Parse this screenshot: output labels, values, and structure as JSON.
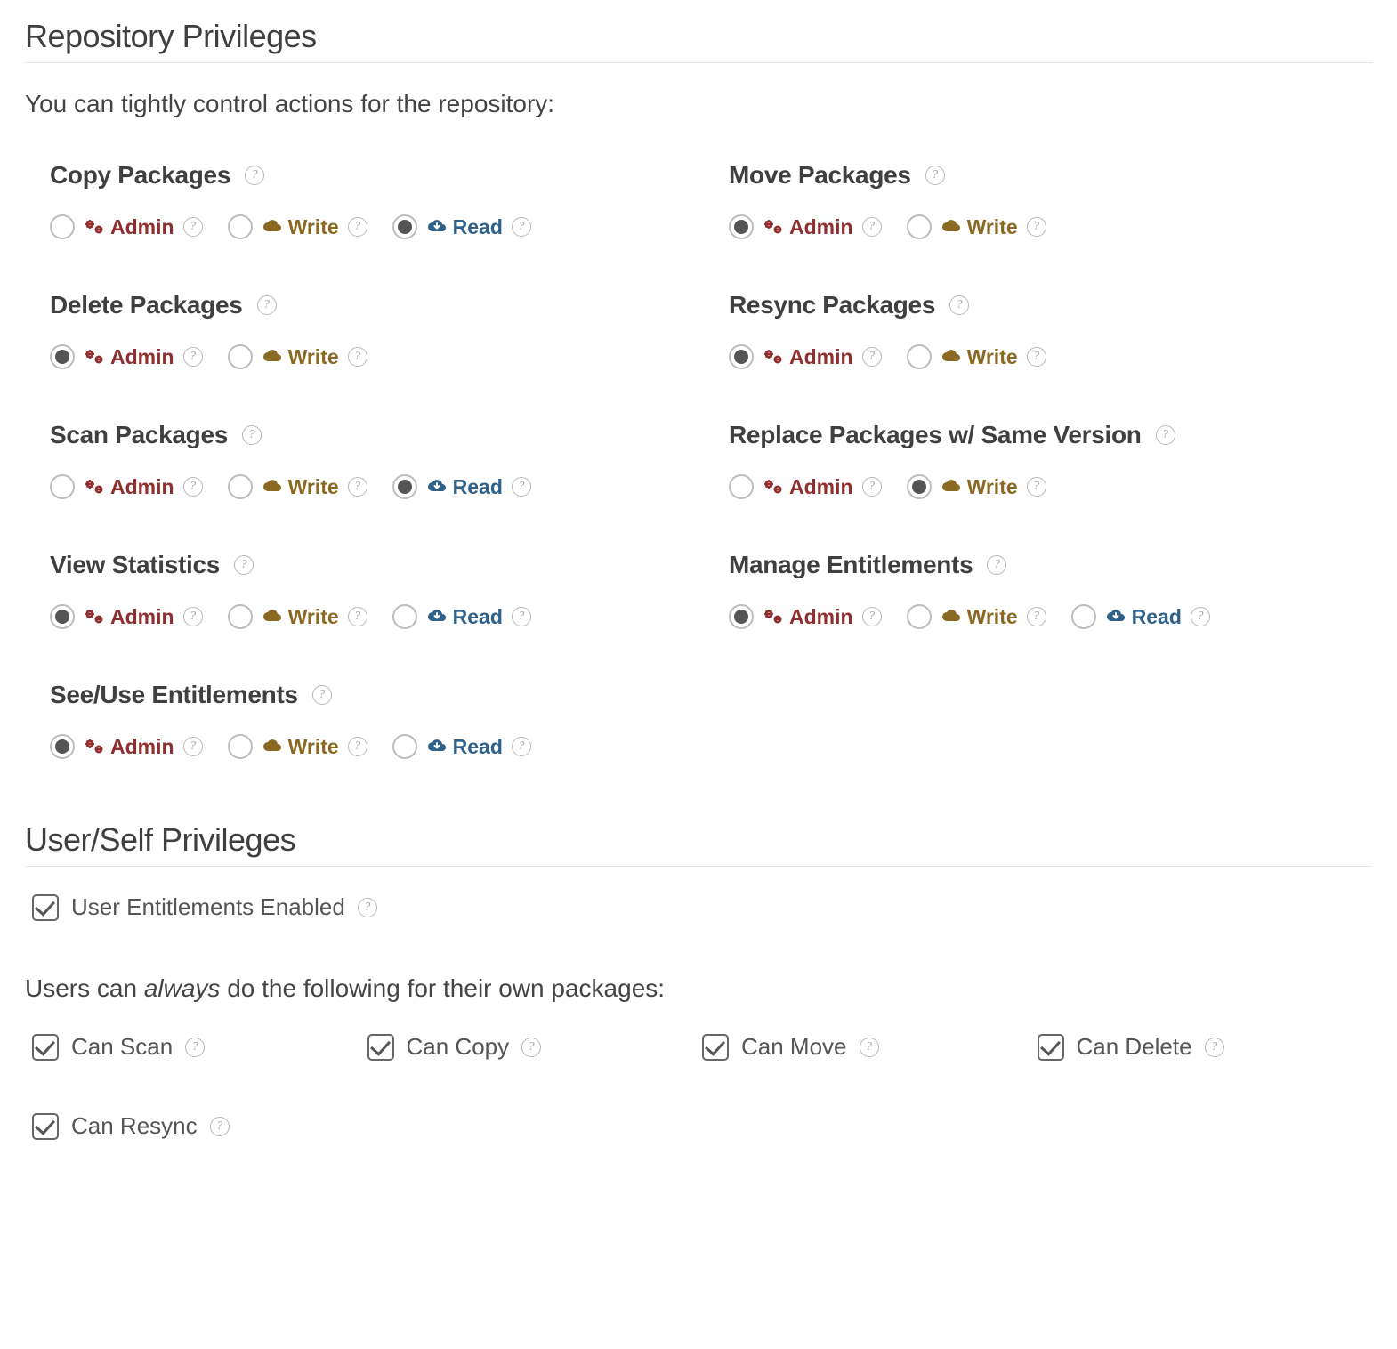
{
  "repo": {
    "title": "Repository Privileges",
    "desc": "You can tightly control actions for the repository:",
    "labels": {
      "admin": "Admin",
      "write": "Write",
      "read": "Read"
    },
    "blocks": [
      {
        "key": "copy",
        "title": "Copy Packages",
        "opts": [
          "admin",
          "write",
          "read"
        ],
        "selected": "read"
      },
      {
        "key": "move",
        "title": "Move Packages",
        "opts": [
          "admin",
          "write"
        ],
        "selected": "admin"
      },
      {
        "key": "delete",
        "title": "Delete Packages",
        "opts": [
          "admin",
          "write"
        ],
        "selected": "admin"
      },
      {
        "key": "resync",
        "title": "Resync Packages",
        "opts": [
          "admin",
          "write"
        ],
        "selected": "admin"
      },
      {
        "key": "scan",
        "title": "Scan Packages",
        "opts": [
          "admin",
          "write",
          "read"
        ],
        "selected": "read"
      },
      {
        "key": "replace",
        "title": "Replace Packages w/ Same Version",
        "opts": [
          "admin",
          "write"
        ],
        "selected": "write"
      },
      {
        "key": "viewstats",
        "title": "View Statistics",
        "opts": [
          "admin",
          "write",
          "read"
        ],
        "selected": "admin"
      },
      {
        "key": "manageent",
        "title": "Manage Entitlements",
        "opts": [
          "admin",
          "write",
          "read"
        ],
        "selected": "admin"
      },
      {
        "key": "seeent",
        "title": "See/Use Entitlements",
        "opts": [
          "admin",
          "write",
          "read"
        ],
        "selected": "admin"
      }
    ]
  },
  "user": {
    "title": "User/Self Privileges",
    "entitlements_label": "User Entitlements Enabled",
    "entitlements_checked": true,
    "desc_pre": "Users can ",
    "desc_em": "always",
    "desc_post": " do the following for their own packages:",
    "checks": [
      {
        "key": "can_scan",
        "label": "Can Scan",
        "checked": true
      },
      {
        "key": "can_copy",
        "label": "Can Copy",
        "checked": true
      },
      {
        "key": "can_move",
        "label": "Can Move",
        "checked": true
      },
      {
        "key": "can_delete",
        "label": "Can Delete",
        "checked": true
      },
      {
        "key": "can_resync",
        "label": "Can Resync",
        "checked": true
      }
    ]
  }
}
